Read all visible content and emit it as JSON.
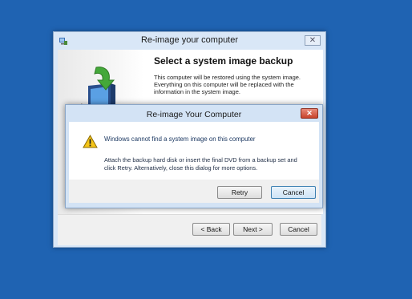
{
  "back_window": {
    "title": "Re-image your computer",
    "heading": "Select a system image backup",
    "description": "This computer will be restored using the system image. Everything on this computer will be replaced with the information in the system image.",
    "buttons": {
      "back": "< Back",
      "next": "Next >",
      "cancel": "Cancel"
    },
    "close_icon": "close-icon"
  },
  "dialog": {
    "title": "Re-image Your Computer",
    "message": "Windows cannot find a system image on this computer",
    "detail": "Attach the backup hard disk or insert the final DVD from a backup set and click Retry. Alternatively, close this dialog for more options.",
    "buttons": {
      "retry": "Retry",
      "cancel": "Cancel"
    },
    "close_symbol": "✕"
  },
  "colors": {
    "desktop": "#1f63b2",
    "close_red": "#c7432b",
    "default_button_border": "#3c7fb1"
  }
}
